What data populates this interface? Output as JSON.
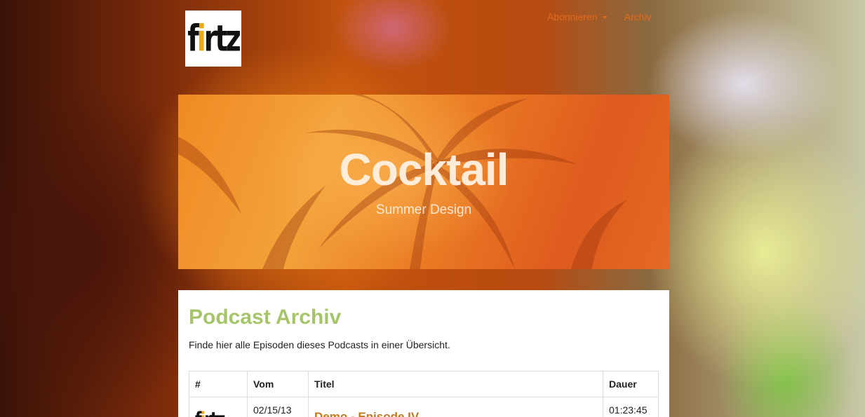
{
  "logo": {
    "prefix": "f",
    "accent": "i",
    "suffix": "rtz"
  },
  "nav": {
    "items": [
      {
        "label": "Abonnieren",
        "has_dropdown": true
      },
      {
        "label": "Archiv",
        "has_dropdown": false
      }
    ],
    "color": "#e36a1c"
  },
  "hero": {
    "title": "Cocktail",
    "subtitle": "Summer Design"
  },
  "main": {
    "heading": "Podcast Archiv",
    "heading_color": "#a6c46a",
    "description": "Finde hier alle Episoden dieses Podcasts in einer Übersicht.",
    "table": {
      "headers": [
        "#",
        "Vom",
        "Titel",
        "Dauer"
      ],
      "rows": [
        {
          "thumb": "firtz-logo-thumbnail",
          "date": "02/15/13",
          "title": "Demo - Episode IV",
          "duration": "01:23:45"
        }
      ]
    }
  }
}
